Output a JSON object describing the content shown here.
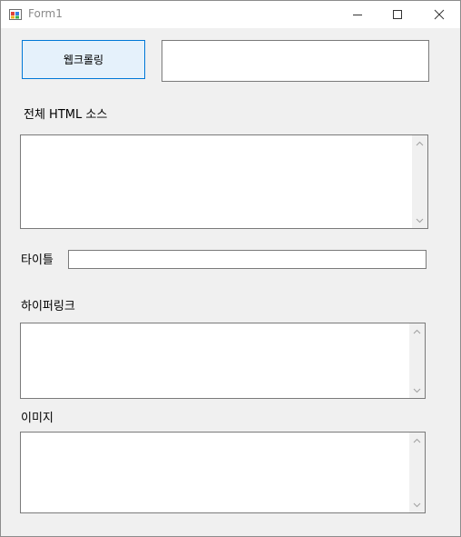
{
  "window": {
    "title": "Form1"
  },
  "form": {
    "crawl_button_label": "웹크롤링",
    "url_value": "",
    "html_source_label": "전체 HTML 소스",
    "html_source_value": "",
    "title_label": "타이틀",
    "title_value": "",
    "hyperlink_label": "하이퍼링크",
    "hyperlink_value": "",
    "image_label": "이미지",
    "image_value": ""
  },
  "icons": {
    "app": "winforms-app-icon",
    "minimize": "minimize-icon",
    "maximize": "maximize-icon",
    "close": "close-icon",
    "scroll_up": "chevron-up-icon",
    "scroll_down": "chevron-down-icon"
  },
  "colors": {
    "button_background": "#e5f1fb",
    "button_border": "#0078d7",
    "form_background": "#f0f0f0",
    "textbox_border": "#7a7a7a"
  }
}
